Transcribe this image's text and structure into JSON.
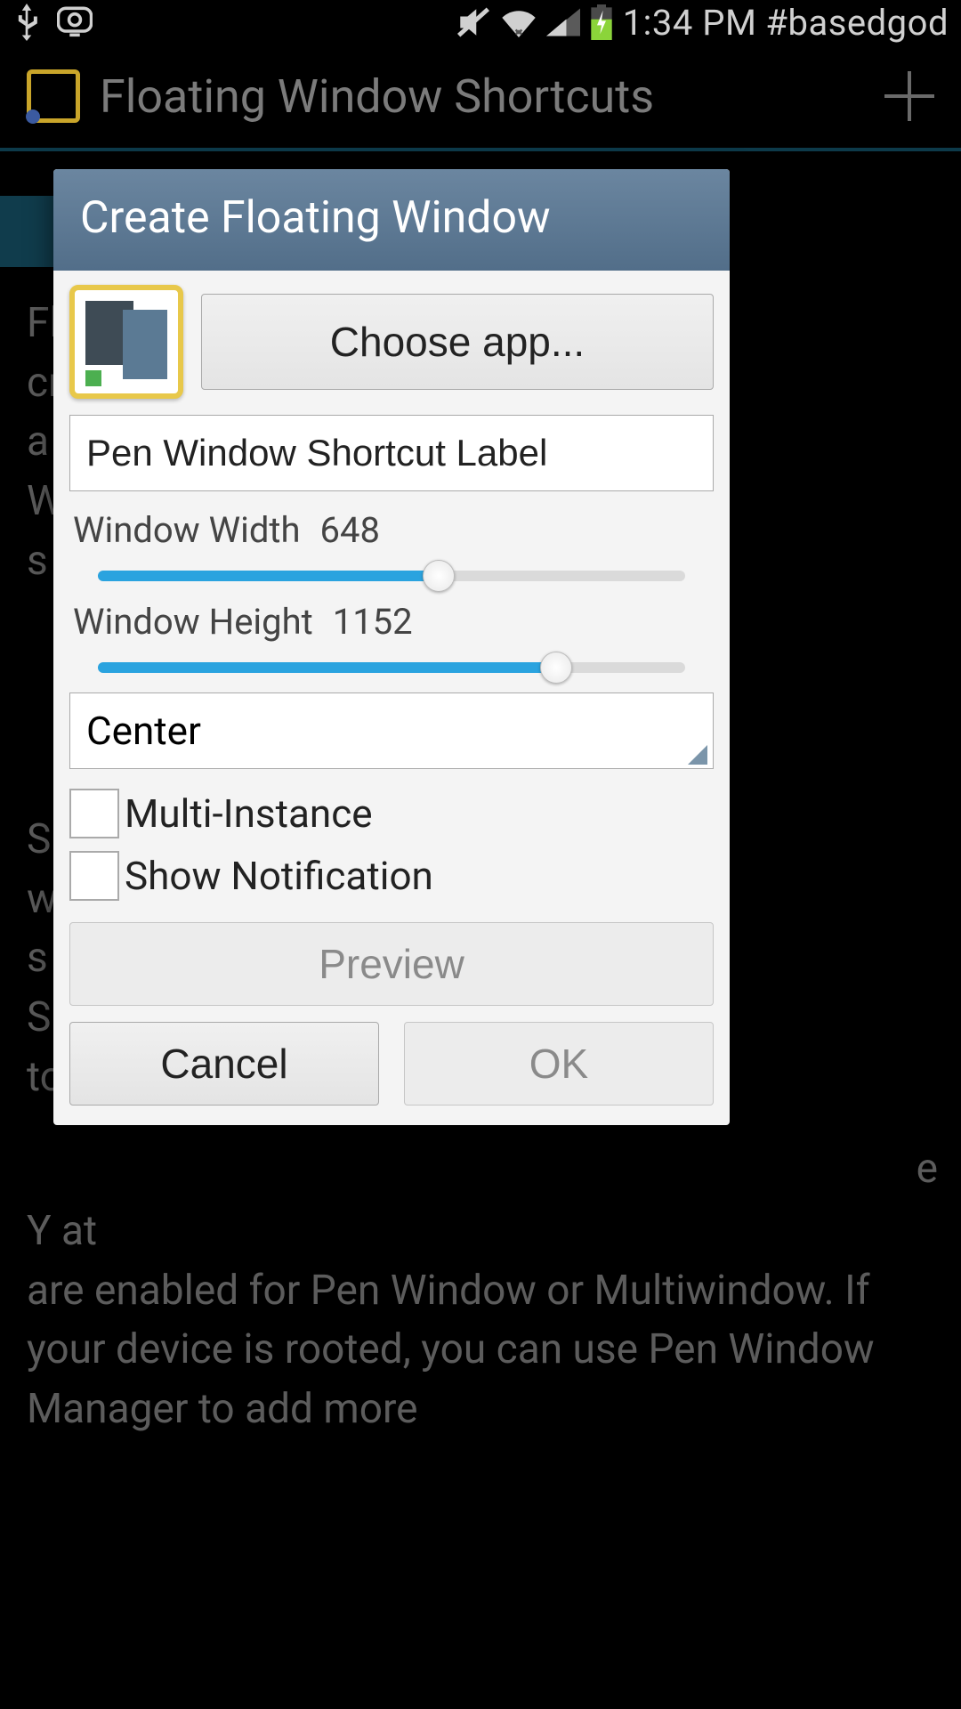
{
  "status": {
    "time": "1:34 PM",
    "suffix": "#basedgod"
  },
  "header": {
    "title": "Floating Window Shortcuts"
  },
  "background": {
    "line_fl": "Fl",
    "line_cr": "cr",
    "line_a": "a",
    "line_w": "W",
    "line_s1": "s",
    "line_s2": "S",
    "line_w2": "w",
    "line_su": "s",
    "line_st": "S",
    "line_to": "to",
    "line_e": "e",
    "line_y": "Y                                                                at",
    "bottom": "are enabled for Pen Window or Multiwindow. If your device is rooted, you can use Pen Window Manager to add more"
  },
  "dialog": {
    "title": "Create Floating Window",
    "choose_app": "Choose app...",
    "label_input": "Pen Window Shortcut Label",
    "width_label": "Window Width",
    "width_value": "648",
    "width_percent": 58,
    "height_label": "Window Height",
    "height_value": "1152",
    "height_percent": 78,
    "position": "Center",
    "multi_instance": "Multi-Instance",
    "show_notification": "Show Notification",
    "preview": "Preview",
    "cancel": "Cancel",
    "ok": "OK"
  }
}
